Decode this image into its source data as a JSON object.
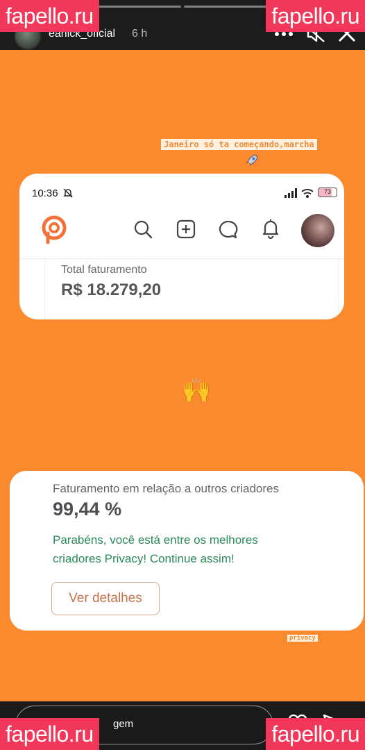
{
  "story_header": {
    "username": "eanick_oficial",
    "time": "6 h",
    "progress_segments": 4,
    "active_segment": 1
  },
  "story": {
    "background_color": "#fb8a2f",
    "caption": "Janeiro só ta começando,marcha",
    "caption_icon": "rocket-icon",
    "sticker": "🙌",
    "tag": "privacy"
  },
  "screenshot_top": {
    "status_time": "10:36",
    "battery": "73",
    "nav_icons": [
      "search-icon",
      "add-icon",
      "chat-icon",
      "bell-icon"
    ],
    "total_label": "Total faturamento",
    "total_value": "R$ 18.279,20"
  },
  "screenshot_bottom": {
    "rank_label": "Faturamento em relação a outros criadores",
    "rank_value": "99,44 %",
    "congrats": "Parabéns, você está entre os melhores criadores Privacy! Continue assim!",
    "details_button": "Ver detalhes"
  },
  "bottom_bar": {
    "message_visible": "gem"
  },
  "watermarks": {
    "top_left": "fapello.ru",
    "top_right": "fapello.ru",
    "bottom_left": "fapello.ru",
    "bottom_right": "fapello.ru"
  },
  "colors": {
    "accent": "#fb8a2f",
    "success_text": "#2a8a5a",
    "watermark": "#f2385a"
  }
}
